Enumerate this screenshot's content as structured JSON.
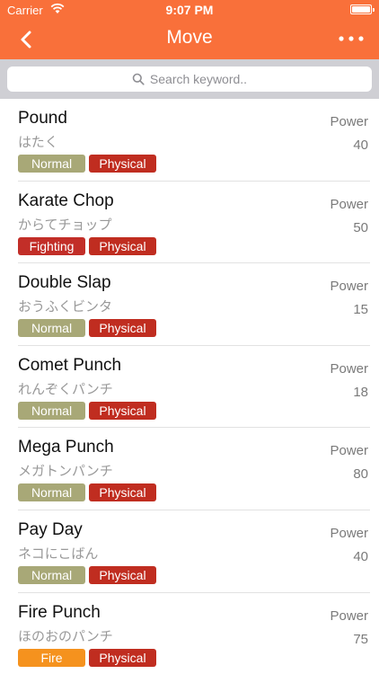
{
  "status_bar": {
    "carrier": "Carrier",
    "time": "9:07 PM"
  },
  "nav": {
    "title": "Move",
    "back_icon": "chevron-left-icon",
    "more_icon": "more-dots-icon"
  },
  "search": {
    "placeholder": "Search keyword..",
    "icon": "search-icon"
  },
  "power_label": "Power",
  "colors": {
    "header": "#f9703a",
    "Normal": "#a8a877",
    "Fighting": "#c22e28",
    "Fire": "#f5921e",
    "Physical": "#c02d20"
  },
  "moves": [
    {
      "name": "Pound",
      "jp": "はたく",
      "type": "Normal",
      "category": "Physical",
      "power": "40"
    },
    {
      "name": "Karate Chop",
      "jp": "からてチョップ",
      "type": "Fighting",
      "category": "Physical",
      "power": "50"
    },
    {
      "name": "Double Slap",
      "jp": "おうふくビンタ",
      "type": "Normal",
      "category": "Physical",
      "power": "15"
    },
    {
      "name": "Comet Punch",
      "jp": "れんぞくパンチ",
      "type": "Normal",
      "category": "Physical",
      "power": "18"
    },
    {
      "name": "Mega Punch",
      "jp": "メガトンパンチ",
      "type": "Normal",
      "category": "Physical",
      "power": "80"
    },
    {
      "name": "Pay Day",
      "jp": "ネコにこばん",
      "type": "Normal",
      "category": "Physical",
      "power": "40"
    },
    {
      "name": "Fire Punch",
      "jp": "ほのおのパンチ",
      "type": "Fire",
      "category": "Physical",
      "power": "75"
    }
  ]
}
